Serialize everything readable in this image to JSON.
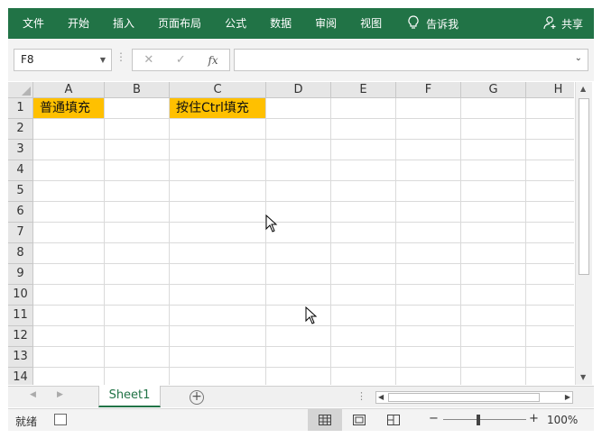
{
  "ribbon": {
    "tabs": [
      "文件",
      "开始",
      "插入",
      "页面布局",
      "公式",
      "数据",
      "审阅",
      "视图"
    ],
    "tell_me": "告诉我",
    "share": "共享"
  },
  "formula_bar": {
    "name_box": "F8",
    "fx_label": "fx",
    "content": ""
  },
  "grid": {
    "columns": [
      "A",
      "B",
      "C",
      "D",
      "E",
      "F",
      "G",
      "H"
    ],
    "rows": [
      "1",
      "2",
      "3",
      "4",
      "5",
      "6",
      "7",
      "8",
      "9",
      "10",
      "11",
      "12",
      "13",
      "14"
    ],
    "cells": {
      "A1": "普通填充",
      "C1": "按住Ctrl填充"
    },
    "fill_color": "#ffc000"
  },
  "sheets": {
    "tabs": [
      "Sheet1"
    ],
    "active": "Sheet1"
  },
  "status": {
    "mode": "就绪",
    "zoom": "100%"
  },
  "colors": {
    "accent": "#217346"
  }
}
